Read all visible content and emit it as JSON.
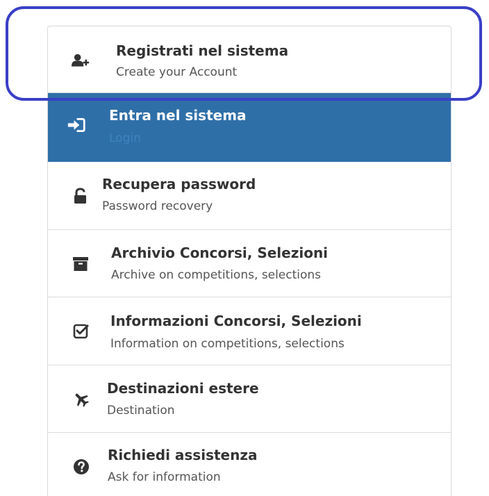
{
  "menu": {
    "items": [
      {
        "title": "Registrati nel sistema",
        "subtitle": "Create your Account",
        "icon": "add-user-icon"
      },
      {
        "title": "Entra nel sistema",
        "subtitle": "Login",
        "icon": "sign-in-icon"
      },
      {
        "title": "Recupera password",
        "subtitle": "Password recovery",
        "icon": "unlock-icon"
      },
      {
        "title": "Archivio Concorsi, Selezioni",
        "subtitle": "Archive on competitions, selections",
        "icon": "archive-icon"
      },
      {
        "title": "Informazioni Concorsi, Selezioni",
        "subtitle": "Information on competitions, selections",
        "icon": "checkbox-icon"
      },
      {
        "title": "Destinazioni estere",
        "subtitle": "Destination",
        "icon": "plane-icon"
      },
      {
        "title": "Richiedi assistenza",
        "subtitle": "Ask for information",
        "icon": "question-icon"
      }
    ]
  },
  "colors": {
    "active_bg": "#2f6fa8",
    "highlight_ring": "#3a3fc7"
  }
}
